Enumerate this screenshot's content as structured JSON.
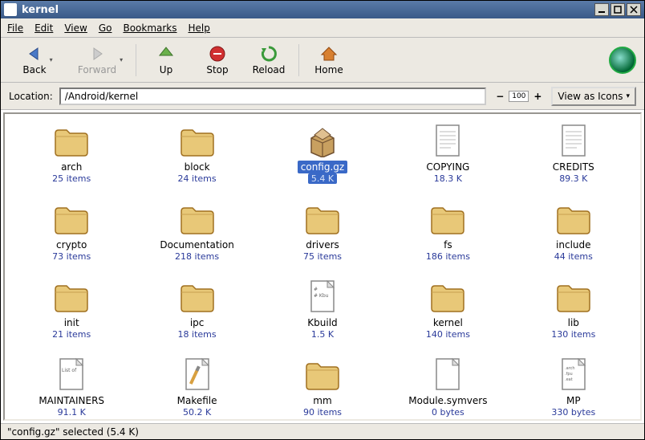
{
  "window": {
    "title": "kernel"
  },
  "menubar": [
    "File",
    "Edit",
    "View",
    "Go",
    "Bookmarks",
    "Help"
  ],
  "toolbar": {
    "back": "Back",
    "forward": "Forward",
    "up": "Up",
    "stop": "Stop",
    "reload": "Reload",
    "home": "Home"
  },
  "location": {
    "label": "Location:",
    "path": "/Android/kernel",
    "zoom": "100",
    "view_mode": "View as Icons"
  },
  "statusbar": {
    "text": "\"config.gz\" selected (5.4 K)"
  },
  "icons": {
    "folder": "folder",
    "package": "package",
    "text": "text",
    "kbuild": "kbuild",
    "makefile": "makefile",
    "blank": "blank",
    "mp": "mp"
  },
  "files": [
    {
      "name": "arch",
      "sub": "25 items",
      "icon": "folder",
      "selected": false
    },
    {
      "name": "block",
      "sub": "24 items",
      "icon": "folder",
      "selected": false
    },
    {
      "name": "config.gz",
      "sub": "5.4 K",
      "icon": "package",
      "selected": true
    },
    {
      "name": "COPYING",
      "sub": "18.3 K",
      "icon": "text",
      "selected": false
    },
    {
      "name": "CREDITS",
      "sub": "89.3 K",
      "icon": "text",
      "selected": false
    },
    {
      "name": "crypto",
      "sub": "73 items",
      "icon": "folder",
      "selected": false
    },
    {
      "name": "Documentation",
      "sub": "218 items",
      "icon": "folder",
      "selected": false
    },
    {
      "name": "drivers",
      "sub": "75 items",
      "icon": "folder",
      "selected": false
    },
    {
      "name": "fs",
      "sub": "186 items",
      "icon": "folder",
      "selected": false
    },
    {
      "name": "include",
      "sub": "44 items",
      "icon": "folder",
      "selected": false
    },
    {
      "name": "init",
      "sub": "21 items",
      "icon": "folder",
      "selected": false
    },
    {
      "name": "ipc",
      "sub": "18 items",
      "icon": "folder",
      "selected": false
    },
    {
      "name": "Kbuild",
      "sub": "1.5 K",
      "icon": "kbuild",
      "selected": false
    },
    {
      "name": "kernel",
      "sub": "140 items",
      "icon": "folder",
      "selected": false
    },
    {
      "name": "lib",
      "sub": "130 items",
      "icon": "folder",
      "selected": false
    },
    {
      "name": "MAINTAINERS",
      "sub": "91.1 K",
      "icon": "listof",
      "selected": false
    },
    {
      "name": "Makefile",
      "sub": "50.2 K",
      "icon": "makefile",
      "selected": false
    },
    {
      "name": "mm",
      "sub": "90 items",
      "icon": "folder",
      "selected": false
    },
    {
      "name": "Module.symvers",
      "sub": "0 bytes",
      "icon": "blank",
      "selected": false
    },
    {
      "name": "MP",
      "sub": "330 bytes",
      "icon": "mp",
      "selected": false
    }
  ]
}
